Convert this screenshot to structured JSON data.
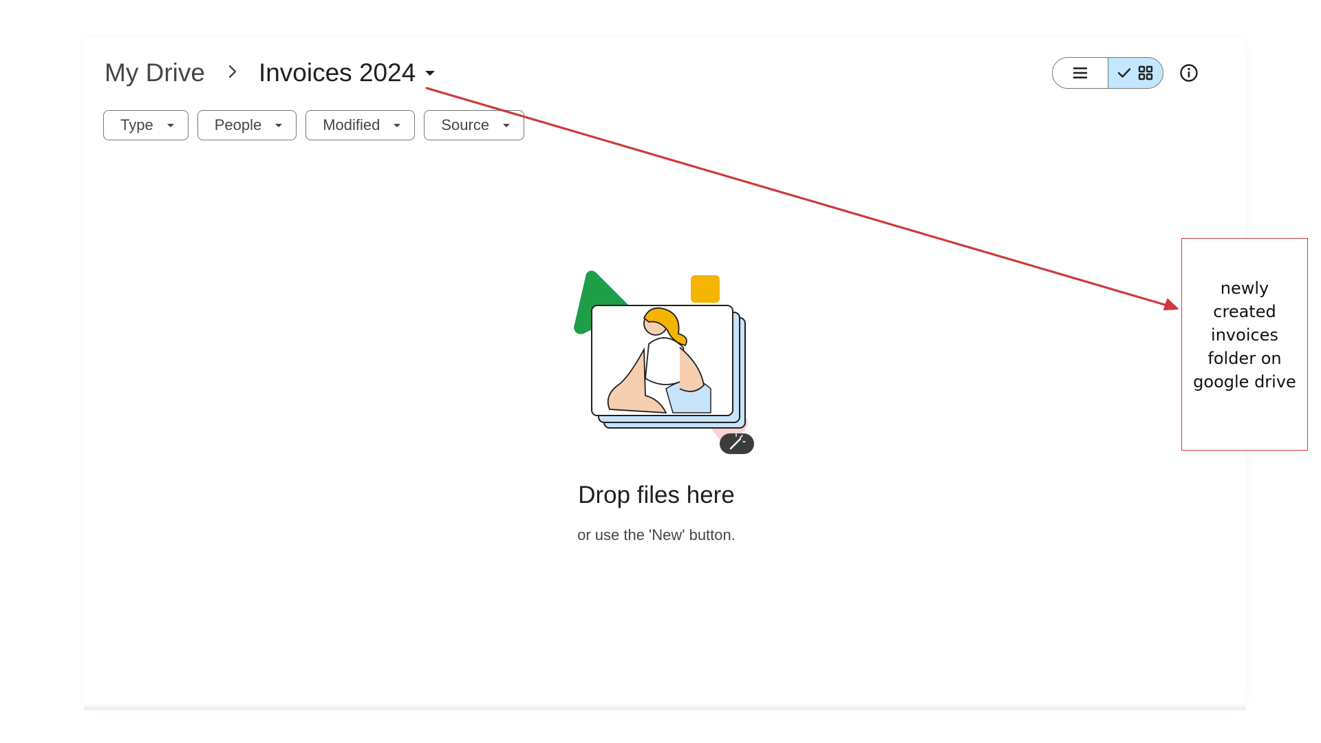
{
  "breadcrumb": {
    "root": "My Drive",
    "separator": "›",
    "current": "Invoices 2024"
  },
  "filters": [
    {
      "label": "Type"
    },
    {
      "label": "People"
    },
    {
      "label": "Modified"
    },
    {
      "label": "Source"
    }
  ],
  "view_toggle": {
    "list_icon": "list-icon",
    "grid_icon": "grid-icon",
    "selected": "grid",
    "check_icon": "check-icon",
    "selected_bg": "#c2e7ff"
  },
  "info_icon": "info-icon",
  "empty_state": {
    "title": "Drop files here",
    "subtitle": "or use the 'New' button."
  },
  "annotation": {
    "lines": [
      "newly",
      "created",
      "invoices",
      "folder on",
      "google drive"
    ],
    "color": "#d9363e"
  }
}
